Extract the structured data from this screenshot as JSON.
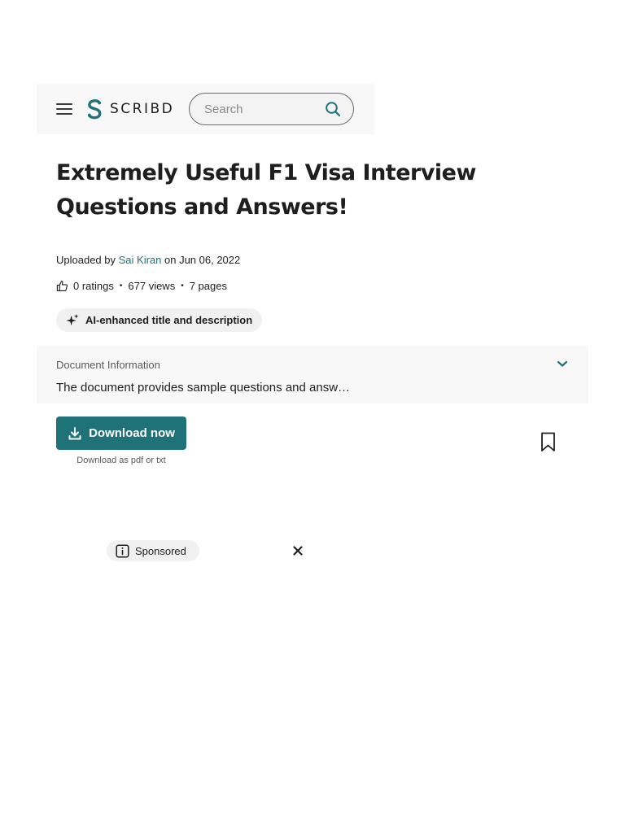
{
  "header": {
    "brand": "SCRIBD",
    "menu_icon": "hamburger-menu-icon",
    "logo_icon": "scribd-logo-icon",
    "search": {
      "placeholder": "Search",
      "icon": "search-icon"
    }
  },
  "document": {
    "title": "Extremely Useful F1 Visa Interview Questions and Answers!",
    "uploaded_prefix": "Uploaded by",
    "author": "Sai Kiran",
    "date_text": "on Jun 06, 2022",
    "ratings": "0 ratings",
    "views": "677 views",
    "pages": "7 pages",
    "separator": "•",
    "ai_chip": "AI-enhanced title and description"
  },
  "doc_info": {
    "label": "Document Information",
    "summary": "The document provides sample questions and answ…"
  },
  "actions": {
    "download_label": "Download now",
    "download_sub": "Download as pdf or txt"
  },
  "ad": {
    "sponsored_label": "Sponsored"
  },
  "colors": {
    "accent": "#1e7278",
    "link": "#1a7478",
    "header_bg": "#f8f8f8",
    "chip_bg": "#f1f1f1"
  }
}
